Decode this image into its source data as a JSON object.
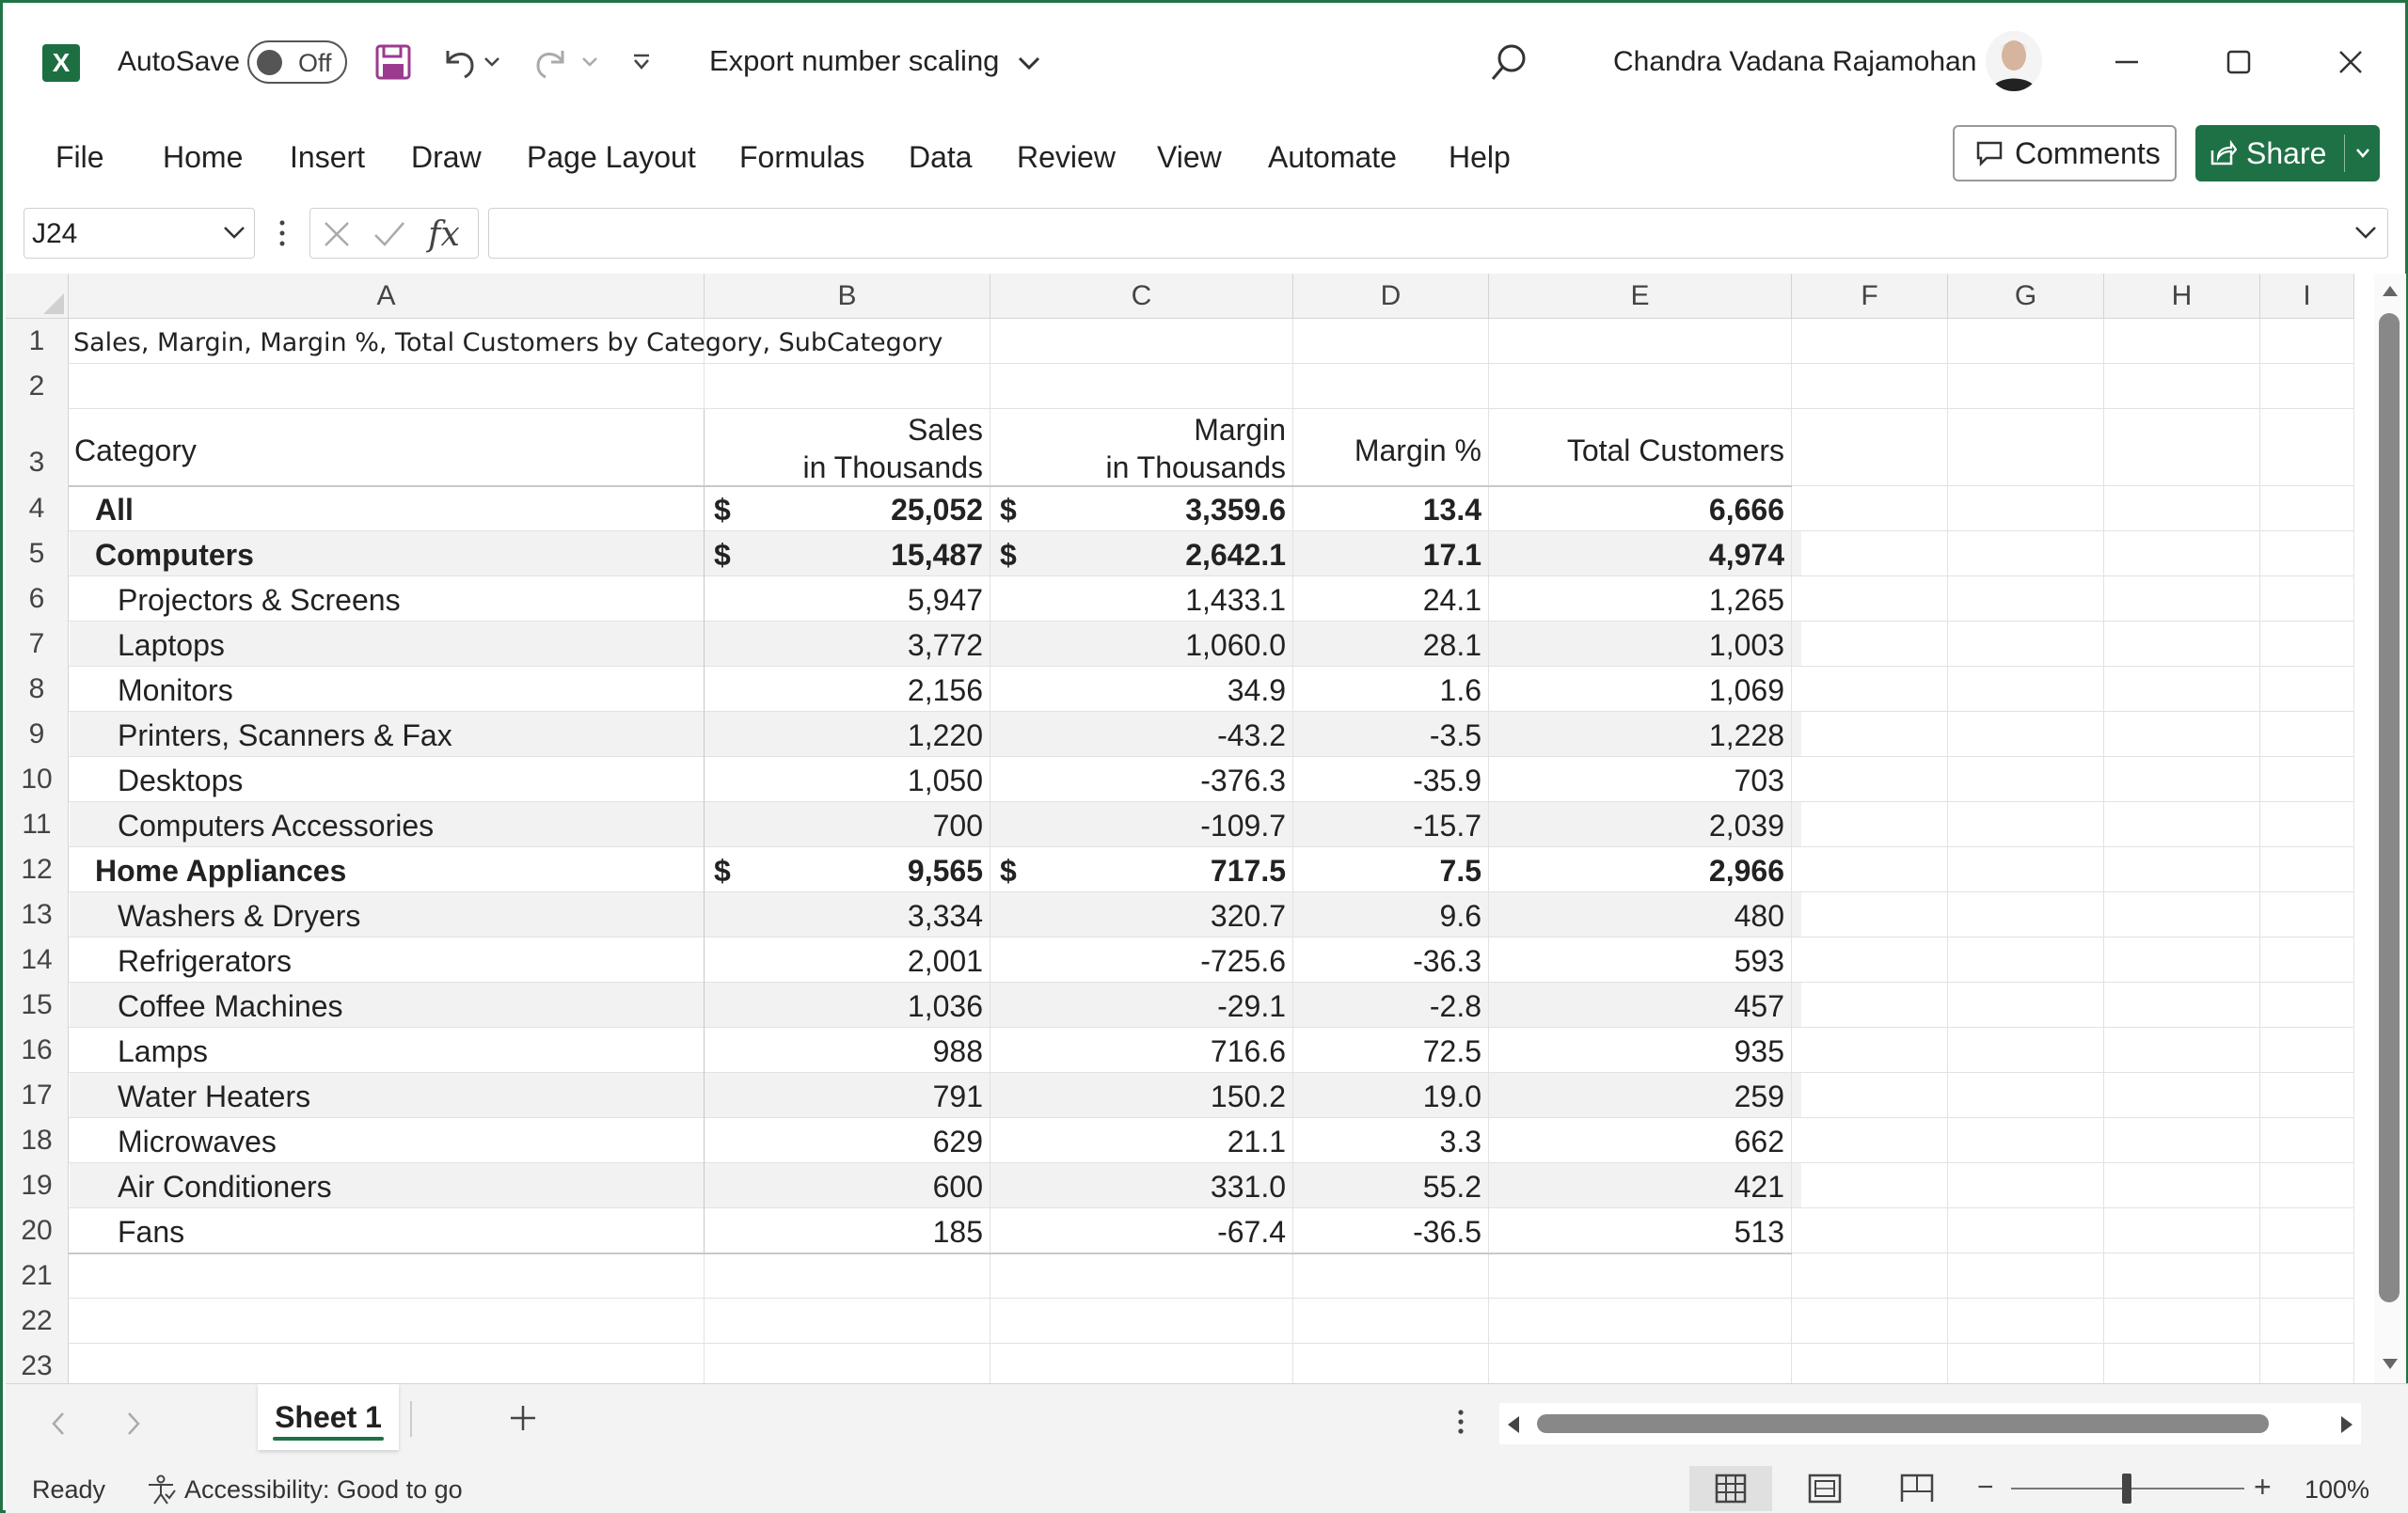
{
  "titlebar": {
    "autosave_label": "AutoSave",
    "autosave_state": "Off",
    "doc_title": "Export number scaling",
    "user_name": "Chandra Vadana Rajamohan"
  },
  "ribbon": {
    "tabs": [
      "File",
      "Home",
      "Insert",
      "Draw",
      "Page Layout",
      "Formulas",
      "Data",
      "Review",
      "View",
      "Automate",
      "Help"
    ],
    "comments_label": "Comments",
    "share_label": "Share"
  },
  "formula_bar": {
    "name_box": "J24",
    "fx_label": "fx",
    "formula": ""
  },
  "sheet": {
    "columns": [
      "A",
      "B",
      "C",
      "D",
      "E",
      "F",
      "G",
      "H",
      "I"
    ],
    "rows": [
      "1",
      "2",
      "3",
      "4",
      "5",
      "6",
      "7",
      "8",
      "9",
      "10",
      "11",
      "12",
      "13",
      "14",
      "15",
      "16",
      "17",
      "18",
      "19",
      "20",
      "21",
      "22",
      "23"
    ],
    "title": "Sales, Margin, Margin %, Total Customers by Category, SubCategory",
    "headers": {
      "category": "Category",
      "sales_l1": "Sales",
      "sales_l2": "in Thousands",
      "margin_l1": "Margin",
      "margin_l2": "in Thousands",
      "margin_pct": "Margin %",
      "customers": "Total Customers"
    },
    "data_rows": [
      {
        "label": "All",
        "sales": "25,052",
        "margin": "3,359.6",
        "pct": "13.4",
        "cust": "6,666",
        "level": 0,
        "currency": "$"
      },
      {
        "label": "Computers",
        "sales": "15,487",
        "margin": "2,642.1",
        "pct": "17.1",
        "cust": "4,974",
        "level": 0,
        "currency": "$"
      },
      {
        "label": "Projectors & Screens",
        "sales": "5,947",
        "margin": "1,433.1",
        "pct": "24.1",
        "cust": "1,265",
        "level": 1,
        "currency": ""
      },
      {
        "label": "Laptops",
        "sales": "3,772",
        "margin": "1,060.0",
        "pct": "28.1",
        "cust": "1,003",
        "level": 1,
        "currency": ""
      },
      {
        "label": "Monitors",
        "sales": "2,156",
        "margin": "34.9",
        "pct": "1.6",
        "cust": "1,069",
        "level": 1,
        "currency": ""
      },
      {
        "label": "Printers, Scanners & Fax",
        "sales": "1,220",
        "margin": "-43.2",
        "pct": "-3.5",
        "cust": "1,228",
        "level": 1,
        "currency": ""
      },
      {
        "label": "Desktops",
        "sales": "1,050",
        "margin": "-376.3",
        "pct": "-35.9",
        "cust": "703",
        "level": 1,
        "currency": ""
      },
      {
        "label": "Computers Accessories",
        "sales": "700",
        "margin": "-109.7",
        "pct": "-15.7",
        "cust": "2,039",
        "level": 1,
        "currency": ""
      },
      {
        "label": "Home Appliances",
        "sales": "9,565",
        "margin": "717.5",
        "pct": "7.5",
        "cust": "2,966",
        "level": 0,
        "currency": "$"
      },
      {
        "label": "Washers & Dryers",
        "sales": "3,334",
        "margin": "320.7",
        "pct": "9.6",
        "cust": "480",
        "level": 1,
        "currency": ""
      },
      {
        "label": "Refrigerators",
        "sales": "2,001",
        "margin": "-725.6",
        "pct": "-36.3",
        "cust": "593",
        "level": 1,
        "currency": ""
      },
      {
        "label": "Coffee Machines",
        "sales": "1,036",
        "margin": "-29.1",
        "pct": "-2.8",
        "cust": "457",
        "level": 1,
        "currency": ""
      },
      {
        "label": "Lamps",
        "sales": "988",
        "margin": "716.6",
        "pct": "72.5",
        "cust": "935",
        "level": 1,
        "currency": ""
      },
      {
        "label": "Water Heaters",
        "sales": "791",
        "margin": "150.2",
        "pct": "19.0",
        "cust": "259",
        "level": 1,
        "currency": ""
      },
      {
        "label": "Microwaves",
        "sales": "629",
        "margin": "21.1",
        "pct": "3.3",
        "cust": "662",
        "level": 1,
        "currency": ""
      },
      {
        "label": "Air Conditioners",
        "sales": "600",
        "margin": "331.0",
        "pct": "55.2",
        "cust": "421",
        "level": 1,
        "currency": ""
      },
      {
        "label": "Fans",
        "sales": "185",
        "margin": "-67.4",
        "pct": "-36.5",
        "cust": "513",
        "level": 1,
        "currency": ""
      }
    ]
  },
  "sheet_tabs": {
    "active": "Sheet 1"
  },
  "status": {
    "ready": "Ready",
    "accessibility": "Accessibility: Good to go",
    "zoom": "100%"
  },
  "colors": {
    "excel_green": "#1e7145",
    "band_gray": "#f2f2f2"
  }
}
